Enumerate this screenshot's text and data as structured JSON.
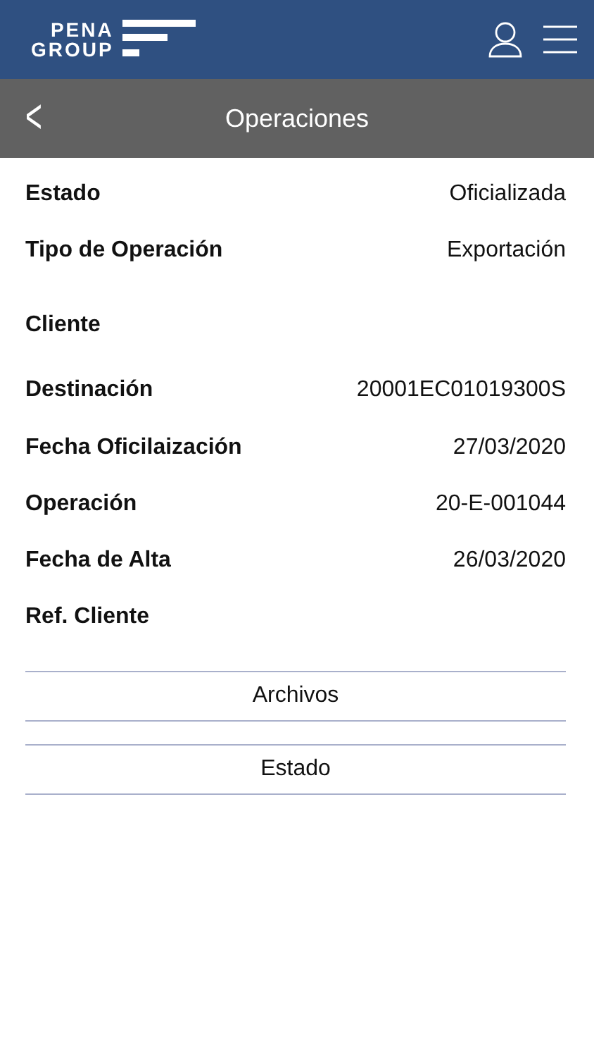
{
  "header": {
    "logo": [
      "PENA",
      "GROUP"
    ]
  },
  "title_bar": {
    "back": "<",
    "title": "Operaciones"
  },
  "fields": [
    {
      "label": "Estado",
      "value": "Oficializada"
    },
    {
      "label": "Tipo de Operación",
      "value": "Exportación"
    },
    {
      "label": "Cliente"
    },
    {
      "label": "Destinación",
      "value": "20001EC01019300S"
    },
    {
      "label": "Fecha Oficilaización",
      "value": "27/03/2020"
    },
    {
      "label": "Operación",
      "value": "20-E-001044"
    },
    {
      "label": "Fecha de Alta",
      "value": "26/03/2020"
    },
    {
      "label": "Ref. Cliente"
    }
  ],
  "buttons": [
    "Archivos",
    "Estado"
  ]
}
